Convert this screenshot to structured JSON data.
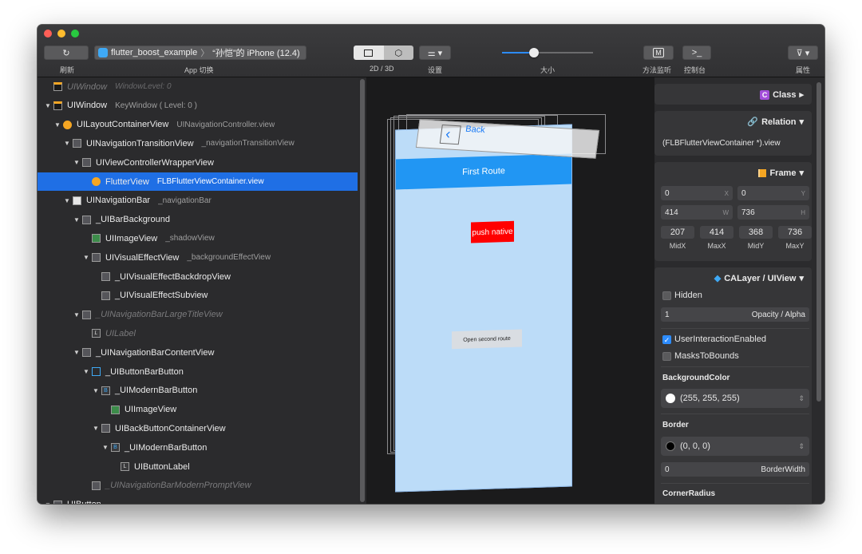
{
  "toolbar": {
    "refresh_label": "刷新",
    "app_label": "App 切换",
    "app_name": "flutter_boost_example",
    "device_name": "“孙恺”的 iPhone (12.4)",
    "view_mode_label": "2D / 3D",
    "settings_label": "设置",
    "size_label": "大小",
    "method_label": "方法监听",
    "console_label": "控制台",
    "attrs_label": "属性",
    "method_button": "M",
    "console_button": ">_",
    "size_value": 0.35
  },
  "hierarchy": [
    {
      "name": "UIWindow",
      "sub": "WindowLevel: 0",
      "indent": 0,
      "tri": "",
      "dim": true
    },
    {
      "name": "UIWindow",
      "sub": "KeyWindow ( Level: 0 )",
      "indent": 0,
      "tri": "▼",
      "dim": false
    },
    {
      "name": "UILayoutContainerView",
      "sub": "UINavigationController.view",
      "indent": 1,
      "tri": "▼",
      "dim": false
    },
    {
      "name": "UINavigationTransitionView",
      "sub": "_navigationTransitionView",
      "indent": 2,
      "tri": "▼",
      "dim": false
    },
    {
      "name": "UIViewControllerWrapperView",
      "sub": "",
      "indent": 3,
      "tri": "▼",
      "dim": false
    },
    {
      "name": "FlutterView",
      "sub": "FLBFlutterViewContainer.view",
      "indent": 4,
      "tri": "",
      "dim": false,
      "selected": true
    },
    {
      "name": "UINavigationBar",
      "sub": "_navigationBar",
      "indent": 2,
      "tri": "▼",
      "dim": false
    },
    {
      "name": "_UIBarBackground",
      "sub": "",
      "indent": 3,
      "tri": "▼",
      "dim": false
    },
    {
      "name": "UIImageView",
      "sub": "_shadowView",
      "indent": 4,
      "tri": "",
      "dim": false
    },
    {
      "name": "UIVisualEffectView",
      "sub": "_backgroundEffectView",
      "indent": 4,
      "tri": "▼",
      "dim": false
    },
    {
      "name": "_UIVisualEffectBackdropView",
      "sub": "",
      "indent": 5,
      "tri": "",
      "dim": false
    },
    {
      "name": "_UIVisualEffectSubview",
      "sub": "",
      "indent": 5,
      "tri": "",
      "dim": false
    },
    {
      "name": "_UINavigationBarLargeTitleView",
      "sub": "",
      "indent": 3,
      "tri": "▼",
      "dim": true
    },
    {
      "name": "UILabel",
      "sub": "",
      "indent": 4,
      "tri": "",
      "dim": true
    },
    {
      "name": "_UINavigationBarContentView",
      "sub": "",
      "indent": 3,
      "tri": "▼",
      "dim": false
    },
    {
      "name": "_UIButtonBarButton",
      "sub": "",
      "indent": 4,
      "tri": "▼",
      "dim": false
    },
    {
      "name": "_UIModernBarButton",
      "sub": "",
      "indent": 5,
      "tri": "▼",
      "dim": false
    },
    {
      "name": "UIImageView",
      "sub": "",
      "indent": 6,
      "tri": "",
      "dim": false
    },
    {
      "name": "UIBackButtonContainerView",
      "sub": "",
      "indent": 5,
      "tri": "▼",
      "dim": false
    },
    {
      "name": "_UIModernBarButton",
      "sub": "",
      "indent": 6,
      "tri": "▼",
      "dim": false
    },
    {
      "name": "UIButtonLabel",
      "sub": "",
      "indent": 7,
      "tri": "",
      "dim": false
    },
    {
      "name": "_UINavigationBarModernPromptView",
      "sub": "",
      "indent": 4,
      "tri": "",
      "dim": true
    },
    {
      "name": "UIButton",
      "sub": "",
      "indent": 0,
      "tri": "▼",
      "dim": false
    }
  ],
  "preview": {
    "nav_back": "Back",
    "title": "First Route",
    "push_native": "push native",
    "open_second": "Open second route"
  },
  "inspector": {
    "class_label": "Class",
    "relation_label": "Relation",
    "relation_value": "(FLBFlutterViewContainer *).view",
    "frame_label": "Frame",
    "x": "0",
    "y": "0",
    "w": "414",
    "h": "736",
    "x_tag": "X",
    "y_tag": "Y",
    "w_tag": "W",
    "h_tag": "H",
    "midx": "207",
    "maxx": "414",
    "midy": "368",
    "maxy": "736",
    "midx_label": "MidX",
    "maxx_label": "MaxX",
    "midy_label": "MidY",
    "maxy_label": "MaxY",
    "layer_label": "CALayer / UIView",
    "hidden_label": "Hidden",
    "opacity_value": "1",
    "opacity_label": "Opacity / Alpha",
    "user_interaction_label": "UserInteractionEnabled",
    "masks_label": "MasksToBounds",
    "bg_color_section": "BackgroundColor",
    "bg_color_value": "(255, 255, 255)",
    "border_section": "Border",
    "border_color_value": "(0, 0, 0)",
    "border_width_value": "0",
    "border_width_label": "BorderWidth",
    "corner_radius_section": "CornerRadius"
  },
  "colors": {
    "selection": "#1f6fe5",
    "flutter_blue": "#2196f3",
    "preview_bg": "#bcdcf8",
    "push_red": "#ff0000"
  }
}
